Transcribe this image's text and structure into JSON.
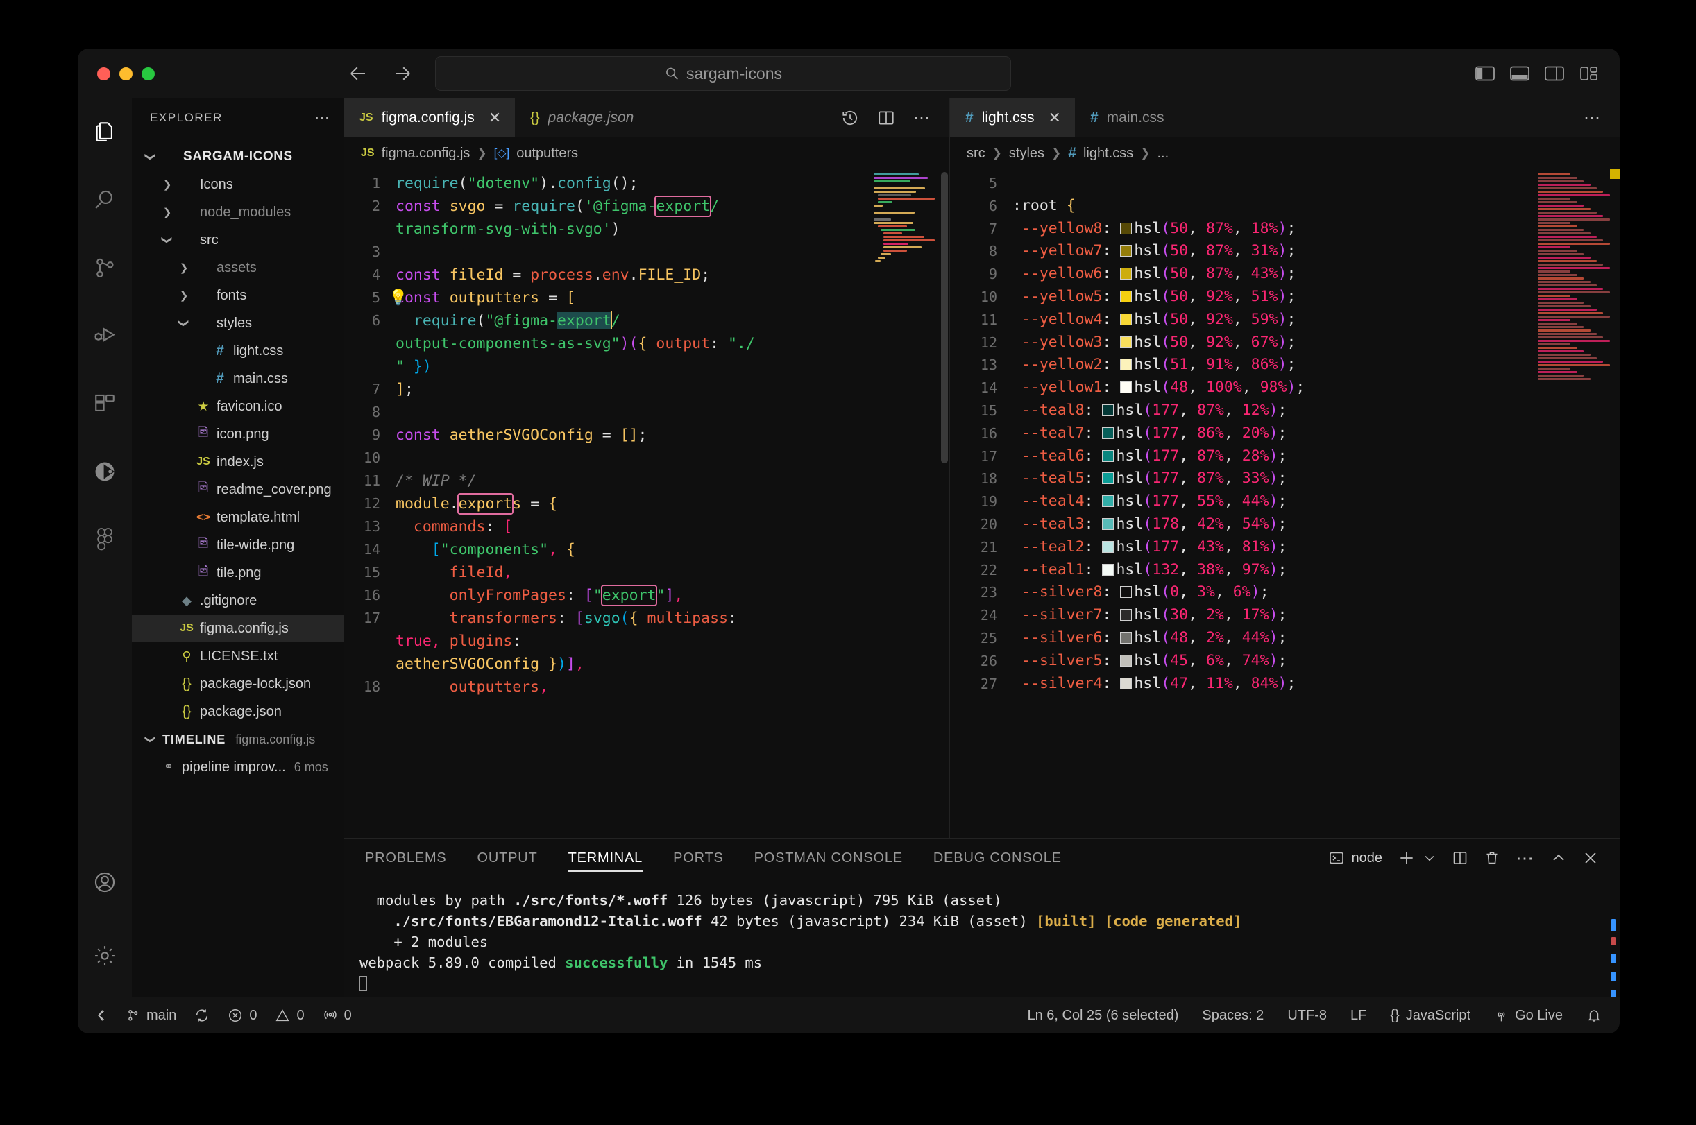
{
  "titlebar": {
    "search_placeholder": "sargam-icons",
    "search_icon": "search-icon",
    "back_icon": "arrow-left-icon",
    "forward_icon": "arrow-right-icon",
    "layout_controls": [
      {
        "name": "toggle-primary-sidebar",
        "icon": "layout-sidebar-left-icon"
      },
      {
        "name": "toggle-panel",
        "icon": "layout-panel-bottom-icon"
      },
      {
        "name": "toggle-secondary-sidebar",
        "icon": "layout-sidebar-right-icon"
      },
      {
        "name": "customize-layout",
        "icon": "layout-grid-icon"
      }
    ]
  },
  "activitybar": {
    "items": [
      {
        "name": "explorer",
        "icon": "files-icon",
        "active": true
      },
      {
        "name": "search",
        "icon": "search-icon",
        "active": false
      },
      {
        "name": "source-control",
        "icon": "source-control-icon",
        "active": false
      },
      {
        "name": "run-and-debug",
        "icon": "run-debug-icon",
        "active": false
      },
      {
        "name": "extensions",
        "icon": "extensions-icon",
        "active": false
      },
      {
        "name": "postman",
        "icon": "postman-icon",
        "active": false
      },
      {
        "name": "figma",
        "icon": "figma-icon",
        "active": false
      }
    ],
    "bottom": [
      {
        "name": "accounts",
        "icon": "account-icon"
      },
      {
        "name": "manage-settings",
        "icon": "gear-icon"
      }
    ]
  },
  "sidebar": {
    "header": "EXPLORER",
    "more_icon": "more-actions-icon",
    "tree": [
      {
        "label": "SARGAM-ICONS",
        "kind": "root",
        "chev": "down",
        "depth": 0,
        "icon": ""
      },
      {
        "label": "Icons",
        "kind": "folder",
        "chev": "right",
        "depth": 1,
        "icon": ""
      },
      {
        "label": "node_modules",
        "kind": "folder-dim",
        "chev": "right",
        "depth": 1,
        "icon": ""
      },
      {
        "label": "src",
        "kind": "folder",
        "chev": "down",
        "depth": 1,
        "icon": ""
      },
      {
        "label": "assets",
        "kind": "folder-dim",
        "chev": "right",
        "depth": 2,
        "icon": ""
      },
      {
        "label": "fonts",
        "kind": "folder",
        "chev": "right",
        "depth": 2,
        "icon": ""
      },
      {
        "label": "styles",
        "kind": "folder",
        "chev": "down",
        "depth": 2,
        "icon": ""
      },
      {
        "label": "light.css",
        "kind": "file",
        "chev": "",
        "depth": 3,
        "icon": "css-icon"
      },
      {
        "label": "main.css",
        "kind": "file",
        "chev": "",
        "depth": 3,
        "icon": "css-icon"
      },
      {
        "label": "favicon.ico",
        "kind": "file",
        "chev": "",
        "depth": 2,
        "icon": "star-icon"
      },
      {
        "label": "icon.png",
        "kind": "file",
        "chev": "",
        "depth": 2,
        "icon": "image-icon"
      },
      {
        "label": "index.js",
        "kind": "file",
        "chev": "",
        "depth": 2,
        "icon": "js-icon"
      },
      {
        "label": "readme_cover.png",
        "kind": "file",
        "chev": "",
        "depth": 2,
        "icon": "image-icon"
      },
      {
        "label": "template.html",
        "kind": "file",
        "chev": "",
        "depth": 2,
        "icon": "html-icon"
      },
      {
        "label": "tile-wide.png",
        "kind": "file",
        "chev": "",
        "depth": 2,
        "icon": "image-icon"
      },
      {
        "label": "tile.png",
        "kind": "file",
        "chev": "",
        "depth": 2,
        "icon": "image-icon"
      },
      {
        "label": ".gitignore",
        "kind": "file",
        "chev": "",
        "depth": 1,
        "icon": "git-icon"
      },
      {
        "label": "figma.config.js",
        "kind": "file-selected",
        "chev": "",
        "depth": 1,
        "icon": "js-icon"
      },
      {
        "label": "LICENSE.txt",
        "kind": "file",
        "chev": "",
        "depth": 1,
        "icon": "key-icon"
      },
      {
        "label": "package-lock.json",
        "kind": "file",
        "chev": "",
        "depth": 1,
        "icon": "json-icon"
      },
      {
        "label": "package.json",
        "kind": "file",
        "chev": "",
        "depth": 1,
        "icon": "json-icon"
      }
    ],
    "timeline": {
      "label": "TIMELINE",
      "file": "figma.config.js",
      "entries": [
        {
          "label": "pipeline improv...",
          "age": "6 mos",
          "icon": "commit-icon"
        }
      ]
    }
  },
  "editor_left": {
    "tabs": [
      {
        "label": "figma.config.js",
        "icon": "js-icon",
        "active": true,
        "closable": true,
        "preview": false
      },
      {
        "label": "package.json",
        "icon": "json-icon",
        "active": false,
        "closable": false,
        "preview": true
      }
    ],
    "actions": [
      {
        "name": "timeline-history",
        "icon": "history-icon"
      },
      {
        "name": "split-editor",
        "icon": "split-editor-icon"
      },
      {
        "name": "more-editor-actions",
        "icon": "more-actions-icon"
      }
    ],
    "breadcrumb": [
      "figma.config.js",
      "outputters"
    ],
    "breadcrumb_icons": [
      "js-icon",
      "symbol-object-icon"
    ],
    "first_line": 1,
    "lines": [
      {
        "n": "1",
        "text": "require(\"dotenv\").config();"
      },
      {
        "n": "2",
        "text": "const svgo = require('@figma-export/"
      },
      {
        "n": "",
        "text": "transform-svg-with-svgo')"
      },
      {
        "n": "3",
        "text": ""
      },
      {
        "n": "4",
        "text": "const fileId = process.env.FILE_ID;"
      },
      {
        "n": "5",
        "text": "const outputters = ["
      },
      {
        "n": "6",
        "text": "  require(\"@figma-export/"
      },
      {
        "n": "",
        "text": "output-components-as-svg\")({ output: \"./"
      },
      {
        "n": "",
        "text": "\" })"
      },
      {
        "n": "7",
        "text": "];"
      },
      {
        "n": "8",
        "text": ""
      },
      {
        "n": "9",
        "text": "const aetherSVGOConfig = [];"
      },
      {
        "n": "10",
        "text": ""
      },
      {
        "n": "11",
        "text": "/* WIP */"
      },
      {
        "n": "12",
        "text": "module.exports = {"
      },
      {
        "n": "13",
        "text": "  commands: ["
      },
      {
        "n": "14",
        "text": "    [\"components\", {"
      },
      {
        "n": "15",
        "text": "      fileId,"
      },
      {
        "n": "16",
        "text": "      onlyFromPages: [\"export\"],"
      },
      {
        "n": "17",
        "text": "      transformers: [svgo({ multipass:"
      },
      {
        "n": "",
        "text": "true, plugins:"
      },
      {
        "n": "",
        "text": "aetherSVGOConfig })],"
      },
      {
        "n": "18",
        "text": "      outputters,"
      }
    ],
    "search_term": "export"
  },
  "editor_right": {
    "tabs": [
      {
        "label": "light.css",
        "icon": "css-icon",
        "active": true,
        "closable": true
      },
      {
        "label": "main.css",
        "icon": "css-icon",
        "active": false,
        "closable": false
      }
    ],
    "more_icon": "more-actions-icon",
    "breadcrumb": [
      "src",
      "styles",
      "light.css",
      "..."
    ],
    "lines": [
      {
        "n": "5",
        "kind": "blank"
      },
      {
        "n": "6",
        "kind": "selector",
        "sel": ":root",
        "brace": "{"
      },
      {
        "n": "7",
        "kind": "var",
        "var": "--yellow8",
        "swatch": "hsl(50, 87%, 18%)",
        "value": "hsl(50, 87%, 18%)"
      },
      {
        "n": "8",
        "kind": "var",
        "var": "--yellow7",
        "swatch": "hsl(50, 87%, 31%)",
        "value": "hsl(50, 87%, 31%)"
      },
      {
        "n": "9",
        "kind": "var",
        "var": "--yellow6",
        "swatch": "hsl(50, 87%, 43%)",
        "value": "hsl(50, 87%, 43%)"
      },
      {
        "n": "10",
        "kind": "var",
        "var": "--yellow5",
        "swatch": "hsl(50, 92%, 51%)",
        "value": "hsl(50, 92%, 51%)"
      },
      {
        "n": "11",
        "kind": "var",
        "var": "--yellow4",
        "swatch": "hsl(50, 92%, 59%)",
        "value": "hsl(50, 92%, 59%)"
      },
      {
        "n": "12",
        "kind": "var",
        "var": "--yellow3",
        "swatch": "hsl(50, 92%, 67%)",
        "value": "hsl(50, 92%, 67%)"
      },
      {
        "n": "13",
        "kind": "var",
        "var": "--yellow2",
        "swatch": "hsl(51, 91%, 86%)",
        "value": "hsl(51, 91%, 86%)"
      },
      {
        "n": "14",
        "kind": "var",
        "var": "--yellow1",
        "swatch": "hsl(48, 100%, 98%)",
        "value": "hsl(48, 100%, 98%)"
      },
      {
        "n": "15",
        "kind": "var",
        "var": "--teal8",
        "swatch": "hsl(177, 87%, 12%)",
        "value": "hsl(177, 87%, 12%)"
      },
      {
        "n": "16",
        "kind": "var",
        "var": "--teal7",
        "swatch": "hsl(177, 86%, 20%)",
        "value": "hsl(177, 86%, 20%)"
      },
      {
        "n": "17",
        "kind": "var",
        "var": "--teal6",
        "swatch": "hsl(177, 87%, 28%)",
        "value": "hsl(177, 87%, 28%)"
      },
      {
        "n": "18",
        "kind": "var",
        "var": "--teal5",
        "swatch": "hsl(177, 87%, 33%)",
        "value": "hsl(177, 87%, 33%)"
      },
      {
        "n": "19",
        "kind": "var",
        "var": "--teal4",
        "swatch": "hsl(177, 55%, 44%)",
        "value": "hsl(177, 55%, 44%)"
      },
      {
        "n": "20",
        "kind": "var",
        "var": "--teal3",
        "swatch": "hsl(178, 42%, 54%)",
        "value": "hsl(178, 42%, 54%)"
      },
      {
        "n": "21",
        "kind": "var",
        "var": "--teal2",
        "swatch": "hsl(177, 43%, 81%)",
        "value": "hsl(177, 43%, 81%)"
      },
      {
        "n": "22",
        "kind": "var",
        "var": "--teal1",
        "swatch": "hsl(132, 38%, 97%)",
        "value": "hsl(132, 38%, 97%)"
      },
      {
        "n": "23",
        "kind": "var",
        "var": "--silver8",
        "swatch": "hsl(0, 3%, 6%)",
        "value": "hsl(0, 3%, 6%)"
      },
      {
        "n": "24",
        "kind": "var",
        "var": "--silver7",
        "swatch": "hsl(30, 2%, 17%)",
        "value": "hsl(30, 2%, 17%)"
      },
      {
        "n": "25",
        "kind": "var",
        "var": "--silver6",
        "swatch": "hsl(48, 2%, 44%)",
        "value": "hsl(48, 2%, 44%)"
      },
      {
        "n": "26",
        "kind": "var",
        "var": "--silver5",
        "swatch": "hsl(45, 6%, 74%)",
        "value": "hsl(45, 6%, 74%)"
      },
      {
        "n": "27",
        "kind": "var",
        "var": "--silver4",
        "swatch": "hsl(47, 11%, 84%)",
        "value": "hsl(47, 11%, 84%)"
      }
    ]
  },
  "panel": {
    "tabs": [
      {
        "label": "PROBLEMS",
        "active": false
      },
      {
        "label": "OUTPUT",
        "active": false
      },
      {
        "label": "TERMINAL",
        "active": true
      },
      {
        "label": "PORTS",
        "active": false
      },
      {
        "label": "POSTMAN CONSOLE",
        "active": false
      },
      {
        "label": "DEBUG CONSOLE",
        "active": false
      }
    ],
    "terminal_name": "node",
    "terminal_icon": "terminal-icon",
    "actions": [
      {
        "name": "new-terminal",
        "icon": "plus-icon"
      },
      {
        "name": "terminal-profile-dropdown",
        "icon": "chevron-down-icon"
      },
      {
        "name": "split-terminal",
        "icon": "split-icon"
      },
      {
        "name": "kill-terminal",
        "icon": "trash-icon"
      },
      {
        "name": "panel-more-actions",
        "icon": "more-actions-icon"
      },
      {
        "name": "maximize-panel",
        "icon": "chevron-up-icon"
      },
      {
        "name": "close-panel",
        "icon": "close-icon"
      }
    ],
    "terminal_lines": [
      [
        {
          "t": "  modules by path ",
          "c": "plain"
        },
        {
          "t": "./src/fonts/*.woff",
          "c": "bold"
        },
        {
          "t": " 126 bytes (javascript) 795 KiB (asset)",
          "c": "plain"
        }
      ],
      [
        {
          "t": "    ./src/fonts/EBGaramond12-Italic.woff",
          "c": "bold"
        },
        {
          "t": " 42 bytes (javascript) 234 KiB (asset) ",
          "c": "plain"
        },
        {
          "t": "[built] [code generated]",
          "c": "yellow"
        }
      ],
      [
        {
          "t": "    + 2 modules",
          "c": "plain"
        }
      ],
      [
        {
          "t": "webpack 5.89.0 compiled ",
          "c": "plain"
        },
        {
          "t": "successfully",
          "c": "green"
        },
        {
          "t": " in 1545 ms",
          "c": "plain"
        }
      ]
    ]
  },
  "statusbar": {
    "left": [
      {
        "name": "remote-window",
        "icon": "remote-icon",
        "label": ""
      },
      {
        "name": "branch",
        "icon": "branch-icon",
        "label": "main"
      },
      {
        "name": "sync-changes",
        "icon": "sync-icon",
        "label": ""
      },
      {
        "name": "errors",
        "icon": "error-icon",
        "label": "0"
      },
      {
        "name": "warnings",
        "icon": "warning-icon",
        "label": "0"
      },
      {
        "name": "ports-forwarded",
        "icon": "radio-tower-icon",
        "label": "0"
      }
    ],
    "right": [
      {
        "name": "cursor-position",
        "label": "Ln 6, Col 25 (6 selected)"
      },
      {
        "name": "indentation",
        "label": "Spaces: 2"
      },
      {
        "name": "encoding",
        "label": "UTF-8"
      },
      {
        "name": "eol",
        "label": "LF"
      },
      {
        "name": "language-mode",
        "label": "JavaScript",
        "icon": "json-brace-icon"
      },
      {
        "name": "go-live",
        "label": "Go Live",
        "icon": "broadcast-icon"
      },
      {
        "name": "notifications",
        "label": "",
        "icon": "bell-icon"
      }
    ]
  },
  "colors": {
    "accent_find": "#e06c9f",
    "tab_active_bg": "#282828",
    "window_bg": "#101010",
    "editor_bg": "#0f0f0f"
  }
}
